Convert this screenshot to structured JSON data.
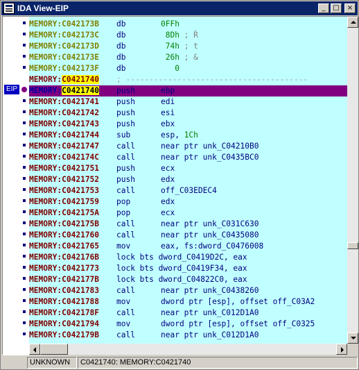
{
  "window": {
    "title": "IDA View-EIP",
    "minimize_glyph": "_",
    "maximize_glyph": "□",
    "close_glyph": "×"
  },
  "eip_label": "EIP",
  "lines": [
    {
      "addr": "MEMORY:C042173B",
      "mnem": "db",
      "ops": "0FFh",
      "comment": "",
      "style": "data"
    },
    {
      "addr": "MEMORY:C042173C",
      "mnem": "db",
      "ops": " 8Dh",
      "comment": "; Ŕ",
      "style": "data"
    },
    {
      "addr": "MEMORY:C042173D",
      "mnem": "db",
      "ops": " 74h",
      "comment": "; t",
      "style": "data"
    },
    {
      "addr": "MEMORY:C042173E",
      "mnem": "db",
      "ops": " 26h",
      "comment": "; &",
      "style": "data"
    },
    {
      "addr": "MEMORY:C042173F",
      "mnem": "db",
      "ops": "   0",
      "comment": "",
      "style": "data"
    },
    {
      "addr": "MEMORY:C0421740",
      "mnem": "",
      "ops": "",
      "comment": "; ---------------------------------------",
      "style": "sep"
    },
    {
      "addr": "MEMORY:C0421740",
      "mnem": "push",
      "ops": "ebp",
      "comment": "",
      "style": "current"
    },
    {
      "addr": "MEMORY:C0421741",
      "mnem": "push",
      "ops": "edi",
      "comment": "",
      "style": "code"
    },
    {
      "addr": "MEMORY:C0421742",
      "mnem": "push",
      "ops": "esi",
      "comment": "",
      "style": "code"
    },
    {
      "addr": "MEMORY:C0421743",
      "mnem": "push",
      "ops": "ebx",
      "comment": "",
      "style": "code"
    },
    {
      "addr": "MEMORY:C0421744",
      "mnem": "sub",
      "ops": "esp, ",
      "num": "1Ch",
      "comment": "",
      "style": "code"
    },
    {
      "addr": "MEMORY:C0421747",
      "mnem": "call",
      "ops": "near ptr unk_C04210B0",
      "comment": "",
      "style": "code"
    },
    {
      "addr": "MEMORY:C042174C",
      "mnem": "call",
      "ops": "near ptr unk_C0435BC0",
      "comment": "",
      "style": "code"
    },
    {
      "addr": "MEMORY:C0421751",
      "mnem": "push",
      "ops": "ecx",
      "comment": "",
      "style": "code"
    },
    {
      "addr": "MEMORY:C0421752",
      "mnem": "push",
      "ops": "edx",
      "comment": "",
      "style": "code"
    },
    {
      "addr": "MEMORY:C0421753",
      "mnem": "call",
      "ops": "off_C03EDEC4",
      "comment": "",
      "style": "code"
    },
    {
      "addr": "MEMORY:C0421759",
      "mnem": "pop",
      "ops": "edx",
      "comment": "",
      "style": "code"
    },
    {
      "addr": "MEMORY:C042175A",
      "mnem": "pop",
      "ops": "ecx",
      "comment": "",
      "style": "code"
    },
    {
      "addr": "MEMORY:C042175B",
      "mnem": "call",
      "ops": "near ptr unk_C031C630",
      "comment": "",
      "style": "code"
    },
    {
      "addr": "MEMORY:C0421760",
      "mnem": "call",
      "ops": "near ptr unk_C0435080",
      "comment": "",
      "style": "code"
    },
    {
      "addr": "MEMORY:C0421765",
      "mnem": "mov",
      "ops": "eax, fs:dword_C0476008",
      "comment": "",
      "style": "code"
    },
    {
      "addr": "MEMORY:C042176B",
      "mnem": "lock bts",
      "ops": "dword_C0419D2C, eax",
      "comment": "",
      "style": "code"
    },
    {
      "addr": "MEMORY:C0421773",
      "mnem": "lock bts",
      "ops": "dword_C0419F34, eax",
      "comment": "",
      "style": "code"
    },
    {
      "addr": "MEMORY:C042177B",
      "mnem": "lock bts",
      "ops": "dword_C04822C0, eax",
      "comment": "",
      "style": "code"
    },
    {
      "addr": "MEMORY:C0421783",
      "mnem": "call",
      "ops": "near ptr unk_C0438260",
      "comment": "",
      "style": "code"
    },
    {
      "addr": "MEMORY:C0421788",
      "mnem": "mov",
      "ops": "dword ptr [esp], offset off_C03A2",
      "comment": "",
      "style": "code"
    },
    {
      "addr": "MEMORY:C042178F",
      "mnem": "call",
      "ops": "near ptr unk_C012D1A0",
      "comment": "",
      "style": "code"
    },
    {
      "addr": "MEMORY:C0421794",
      "mnem": "mov",
      "ops": "dword ptr [esp], offset off_C0325",
      "comment": "",
      "style": "code"
    },
    {
      "addr": "MEMORY:C042179B",
      "mnem": "call",
      "ops": "near ptr unk_C012D1A0",
      "comment": "",
      "style": "code"
    }
  ],
  "status": {
    "segment": "UNKNOWN",
    "location": "C0421740: MEMORY:C0421740"
  },
  "colors": {
    "code_bg": "#c0ffff",
    "current_line": "#800080",
    "address": "#800000",
    "address_data": "#808000",
    "highlight": "#ffff00",
    "titlebar": "#0a246a"
  },
  "vscroll_position": 0.72,
  "hscroll_position": 0.0
}
